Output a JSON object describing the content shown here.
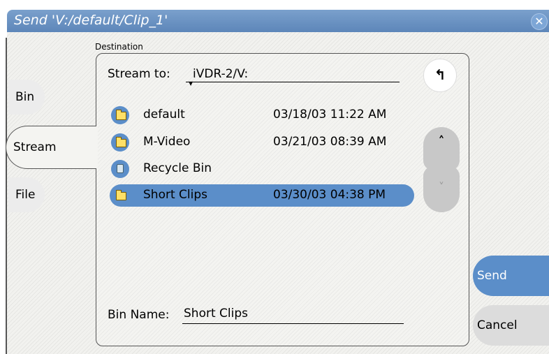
{
  "window": {
    "title": "Send 'V:/default/Clip_1'"
  },
  "destination_label": "Destination",
  "tabs": [
    {
      "label": "Bin"
    },
    {
      "label": "Stream"
    },
    {
      "label": "File"
    }
  ],
  "stream_to": {
    "label": "Stream to:",
    "value": "iVDR-2/V:"
  },
  "items": [
    {
      "name": "default",
      "date": "03/18/03 11:22 AM",
      "type": "folder",
      "selected": false
    },
    {
      "name": "M-Video",
      "date": "03/21/03 08:39 AM",
      "type": "folder",
      "selected": false
    },
    {
      "name": "Recycle Bin",
      "date": "",
      "type": "recycle-bin",
      "selected": false
    },
    {
      "name": "Short Clips",
      "date": "03/30/03 04:38 PM",
      "type": "folder",
      "selected": true
    }
  ],
  "bin_name": {
    "label": "Bin Name:",
    "value": "Short Clips"
  },
  "buttons": {
    "send": "Send",
    "cancel": "Cancel"
  },
  "icons": {
    "close": "close-icon",
    "up_level": "up-arrow-icon",
    "scroll_up": "chevron-up-icon",
    "scroll_down": "chevron-down-icon",
    "folder": "folder-icon",
    "recycle": "recycle-bin-icon"
  },
  "colors": {
    "title_bar": "#6a93c3",
    "selected_row": "#5b8ec9",
    "send_button": "#5b8ec9"
  }
}
